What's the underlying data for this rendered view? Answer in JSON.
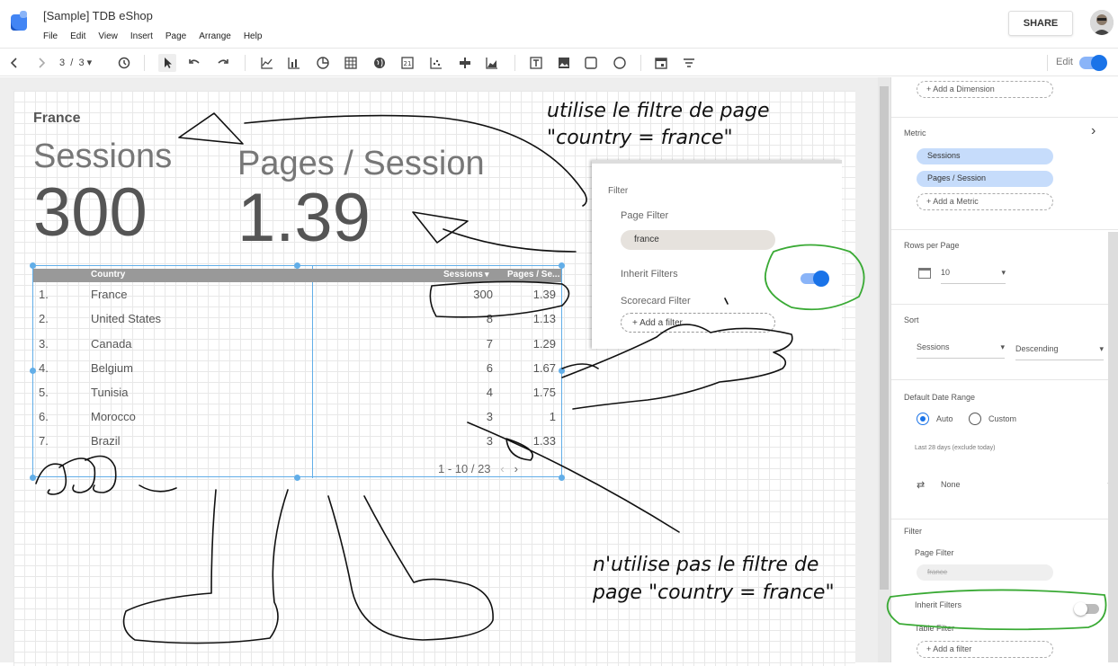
{
  "app": {
    "title": "[Sample]  TDB eShop",
    "share_label": "SHARE"
  },
  "menu": [
    "File",
    "Edit",
    "View",
    "Insert",
    "Page",
    "Arrange",
    "Help"
  ],
  "toolbar": {
    "page_current": "3",
    "page_sep": "/",
    "page_total": "3",
    "edit_label": "Edit"
  },
  "report": {
    "title": "France",
    "scorecards": [
      {
        "label": "Sessions",
        "value": "300"
      },
      {
        "label": "Pages / Session",
        "value": "1.39"
      }
    ],
    "table": {
      "headers": [
        "Country",
        "Sessions",
        "Pages / Se..."
      ],
      "rows": [
        {
          "n": "1.",
          "country": "France",
          "sessions": "300",
          "pps": "1.39"
        },
        {
          "n": "2.",
          "country": "United States",
          "sessions": "8",
          "pps": "1.13"
        },
        {
          "n": "3.",
          "country": "Canada",
          "sessions": "7",
          "pps": "1.29"
        },
        {
          "n": "4.",
          "country": "Belgium",
          "sessions": "6",
          "pps": "1.67"
        },
        {
          "n": "5.",
          "country": "Tunisia",
          "sessions": "4",
          "pps": "1.75"
        },
        {
          "n": "6.",
          "country": "Morocco",
          "sessions": "3",
          "pps": "1"
        },
        {
          "n": "7.",
          "country": "Brazil",
          "sessions": "3",
          "pps": "1.33"
        }
      ],
      "pager": "1 - 10 / 23"
    }
  },
  "filter_panel": {
    "title": "Filter",
    "page_filter_label": "Page Filter",
    "page_filter_value": "france",
    "inherit_label": "Inherit Filters",
    "inherit_on": true,
    "scorecard_filter_label": "Scorecard Filter",
    "add_filter": "+ Add a filter"
  },
  "properties": {
    "add_dimension": "+ Add a Dimension",
    "metric_title": "Metric",
    "metrics": [
      "Sessions",
      "Pages / Session"
    ],
    "add_metric": "+ Add a Metric",
    "rows_title": "Rows per Page",
    "rows_value": "10",
    "sort_title": "Sort",
    "sort_field": "Sessions",
    "sort_order": "Descending",
    "date_title": "Default Date Range",
    "date_auto": "Auto",
    "date_custom": "Custom",
    "date_note": "Last 28 days (exclude today)",
    "compare_value": "None",
    "filter_title": "Filter",
    "page_filter_label": "Page Filter",
    "page_filter_value": "france",
    "inherit_label": "Inherit Filters",
    "inherit_on": false,
    "table_filter_label": "Table Filter",
    "add_filter": "+ Add a filter"
  },
  "annotations": {
    "top_line1": "utilise le filtre de page",
    "top_line2": "\"country = france\"",
    "bottom_line1": "n'utilise pas le filtre de",
    "bottom_line2": "page \"country = france\""
  },
  "colors": {
    "accent": "#1a73e8",
    "selection": "#62aee8",
    "chip": "#c6dcfb",
    "highlight": "#3aaa35"
  }
}
